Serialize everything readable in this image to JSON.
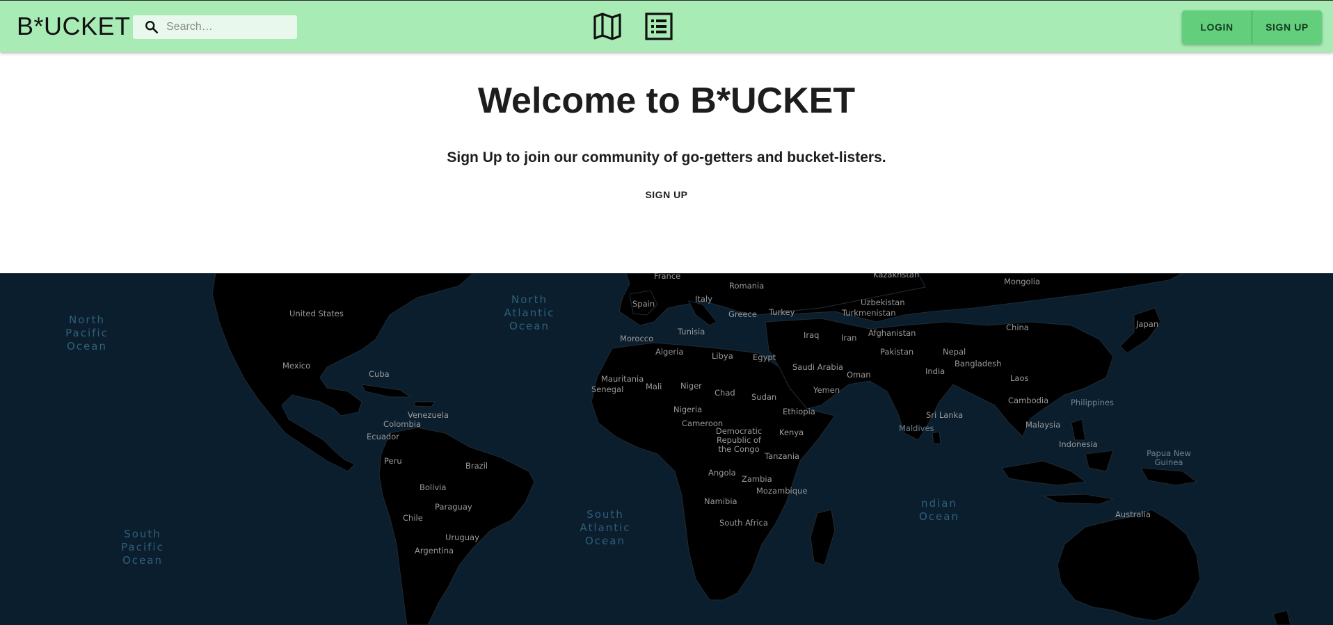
{
  "header": {
    "brand": "B*UCKET",
    "search_placeholder": "Search…",
    "login_label": "LOGIN",
    "signup_label": "SIGN UP",
    "icons": [
      "search-icon",
      "map-icon",
      "list-icon"
    ]
  },
  "hero": {
    "title": "Welcome to B*UCKET",
    "subtitle": "Sign Up to join our community of go-getters and bucket-listers.",
    "cta": "SIGN UP"
  },
  "map": {
    "oceans": [
      "North Pacific Ocean",
      "North Atlantic Ocean",
      "South Atlantic Ocean",
      "South Pacific Ocean",
      "ndian Ocean"
    ],
    "countries": [
      "France",
      "Romania",
      "Kazakhstan",
      "Mongolia",
      "Italy",
      "Spain",
      "Greece",
      "Turkey",
      "Uzbekistan",
      "Turkmenistan",
      "United States",
      "China",
      "Japan",
      "Tunisia",
      "Morocco",
      "Iraq",
      "Iran",
      "Afghanistan",
      "Algeria",
      "Libya",
      "Egypt",
      "Pakistan",
      "Nepal",
      "Bangladesh",
      "Mexico",
      "Cuba",
      "Saudi Arabia",
      "Oman",
      "India",
      "Laos",
      "Mauritania",
      "Mali",
      "Niger",
      "Chad",
      "Sudan",
      "Yemen",
      "Senegal",
      "Cambodia",
      "Philippines",
      "Venezuela",
      "Nigeria",
      "Ethiopia",
      "Sri Lanka",
      "Colombia",
      "Cameroon",
      "Malaysia",
      "Ecuador",
      "Democratic Republic of the Congo",
      "Kenya",
      "Maldives",
      "Indonesia",
      "Papua New Guinea",
      "Peru",
      "Brazil",
      "Tanzania",
      "Angola",
      "Zambia",
      "Bolivia",
      "Mozambique",
      "Paraguay",
      "Namibia",
      "Chile",
      "South Africa",
      "Australia",
      "Uruguay",
      "Argentina"
    ],
    "colors": {
      "ocean": "#0b1e2e",
      "land": "#000000",
      "header": "#a8ebb5",
      "button": "#63cf7d"
    }
  }
}
